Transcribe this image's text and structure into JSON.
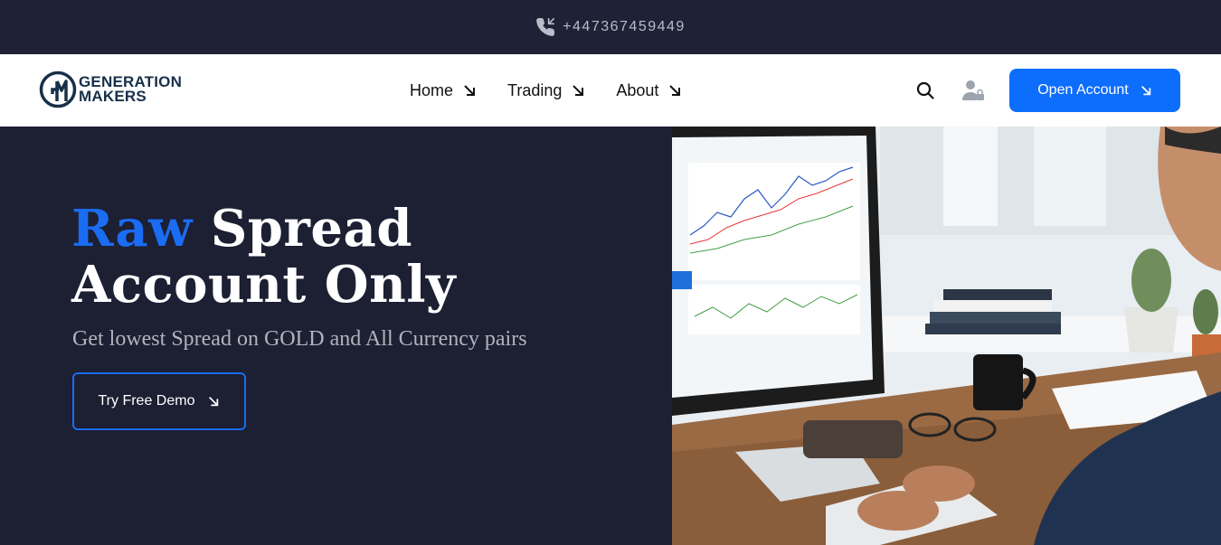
{
  "topbar": {
    "phone": "+447367459449",
    "icon": "phone-incoming-icon"
  },
  "logo": {
    "line1": "GENERATION",
    "line2": "MAKERS",
    "mark": "GM"
  },
  "nav": {
    "items": [
      {
        "label": "Home"
      },
      {
        "label": "Trading"
      },
      {
        "label": "About"
      }
    ]
  },
  "actions": {
    "search_icon": "search-icon",
    "user_icon": "user-lock-icon",
    "open_account": "Open Account"
  },
  "hero": {
    "headline_accent": "Raw",
    "headline_rest": "Spread",
    "headline_line2": "Account Only",
    "subtitle": "Get lowest Spread on GOLD and All Currency pairs",
    "demo_button": "Try Free Demo"
  },
  "colors": {
    "primary": "#0d6efd",
    "dark_bg": "#1d1f33",
    "accent_text": "#1a6cf2"
  }
}
